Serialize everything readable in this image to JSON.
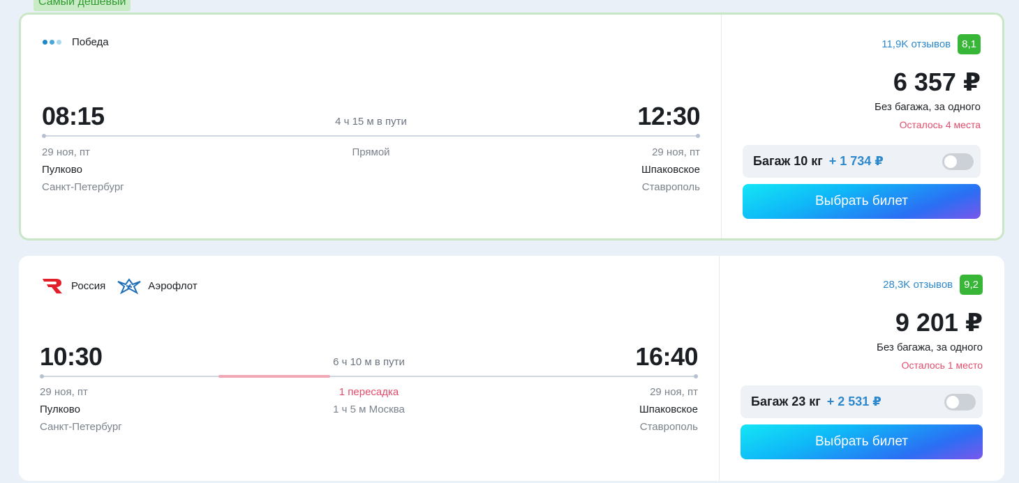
{
  "badge": "Самый дешевый",
  "colors": {
    "accent_blue": "#2d88cc",
    "rating_green": "#37b637",
    "alert_red": "#e24d6b",
    "pobeda_dots": [
      "#1e88c7",
      "#4aa8d8",
      "#a8d8f0"
    ]
  },
  "flights": [
    {
      "airlines": [
        {
          "name": "Победа",
          "icon": "pobeda-dots-logo"
        }
      ],
      "departure": {
        "time": "08:15",
        "date": "29 ноя, пт",
        "airport": "Пулково",
        "city": "Санкт-Петербург"
      },
      "arrival": {
        "time": "12:30",
        "date": "29 ноя, пт",
        "airport": "Шпаковское",
        "city": "Ставрополь"
      },
      "duration": "4 ч 15 м в пути",
      "stops": "Прямой",
      "layover": "",
      "reviews": "11,9K отзывов",
      "rating": "8,1",
      "price": "6 357 ₽",
      "price_note": "Без багажа, за одного",
      "seats_left": "Осталось 4 места",
      "baggage_label": "Багаж 10 кг",
      "baggage_price": "+ 1 734 ₽",
      "button": "Выбрать билет"
    },
    {
      "airlines": [
        {
          "name": "Россия",
          "icon": "rossiya-logo"
        },
        {
          "name": "Аэрофлот",
          "icon": "aeroflot-logo"
        }
      ],
      "departure": {
        "time": "10:30",
        "date": "29 ноя, пт",
        "airport": "Пулково",
        "city": "Санкт-Петербург"
      },
      "arrival": {
        "time": "16:40",
        "date": "29 ноя, пт",
        "airport": "Шпаковское",
        "city": "Ставрополь"
      },
      "duration": "6 ч 10 м в пути",
      "stops": "1 пересадка",
      "layover": "1 ч 5 м Москва",
      "reviews": "28,3K отзывов",
      "rating": "9,2",
      "price": "9 201 ₽",
      "price_note": "Без багажа, за одного",
      "seats_left": "Осталось 1 место",
      "baggage_label": "Багаж 23 кг",
      "baggage_price": "+ 2 531 ₽",
      "button": "Выбрать билет"
    }
  ]
}
